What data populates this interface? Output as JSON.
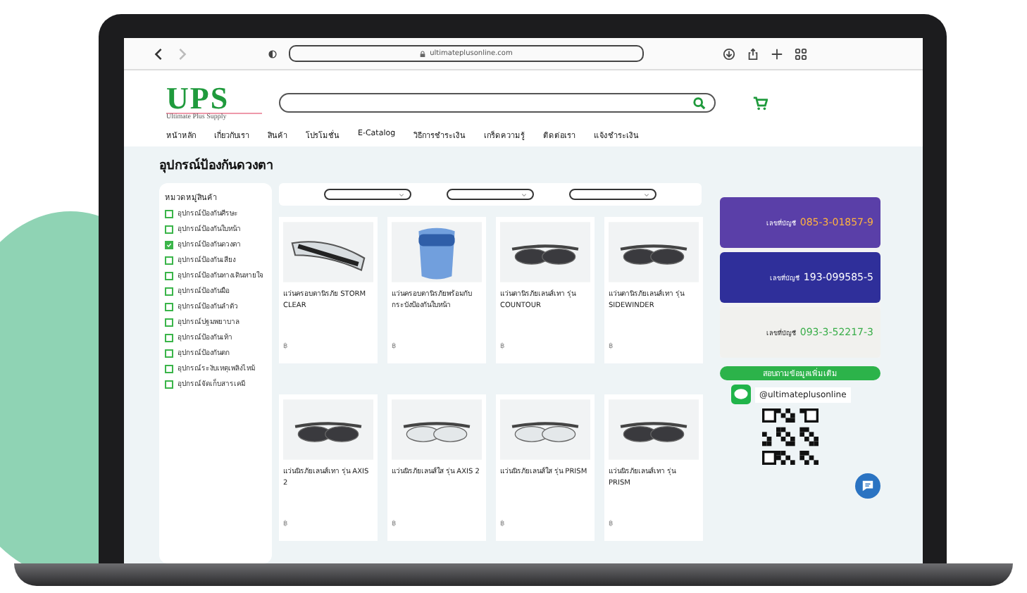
{
  "browser": {
    "url": "ultimateplusonline.com"
  },
  "logo": {
    "mark": "UPS",
    "tagline": "Ultimate Plus Supply"
  },
  "nav": [
    "หน้าหลัก",
    "เกี่ยวกับเรา",
    "สินค้า",
    "โปรโมชั่น",
    "E-Catalog",
    "วิธีการชำระเงิน",
    "เกร็ดความรู้",
    "ติดต่อเรา",
    "แจ้งชำระเงิน"
  ],
  "page_title": "อุปกรณ์ป้องกันดวงตา",
  "sidebar": {
    "title": "หมวดหมู่สินค้า",
    "items": [
      {
        "label": "อุปกรณ์ป้องกันศีรษะ",
        "checked": false
      },
      {
        "label": "อุปกรณ์ป้องกันใบหน้า",
        "checked": false
      },
      {
        "label": "อุปกรณ์ป้องกันดวงตา",
        "checked": true
      },
      {
        "label": "อุปกรณ์ป้องกันเสียง",
        "checked": false
      },
      {
        "label": "อุปกรณ์ป้องกันทางเดินหายใจ",
        "checked": false
      },
      {
        "label": "อุปกรณ์ป้องกันมือ",
        "checked": false
      },
      {
        "label": "อุปกรณ์ป้องกันลำตัว",
        "checked": false
      },
      {
        "label": "อุปกรณ์ปฐมพยาบาล",
        "checked": false
      },
      {
        "label": "อุปกรณ์ป้องกันเท้า",
        "checked": false
      },
      {
        "label": "อุปกรณ์ป้องกันตก",
        "checked": false
      },
      {
        "label": "อุปกรณ์ระงับเหตุเพลิงไหม้",
        "checked": false
      },
      {
        "label": "อุปกรณ์จัดเก็บสารเคมี",
        "checked": false
      }
    ]
  },
  "products": [
    {
      "name": "แว่นครอบตานิรภัย STORM CLEAR",
      "price": "฿",
      "kind": "goggles"
    },
    {
      "name": "แว่นครอบตานิรภัยพร้อมกับกระบังป้องกันใบหน้า",
      "price": "฿",
      "kind": "faceshield"
    },
    {
      "name": "แว่นตานิรภัยเลนส์เทา รุ่น COUNTOUR",
      "price": "฿",
      "kind": "dark"
    },
    {
      "name": "แว่นตานิรภัยเลนส์เทา รุ่น SIDEWINDER",
      "price": "฿",
      "kind": "dark"
    },
    {
      "name": "แว่นนิรภัยเลนส์เทา รุ่น AXIS 2",
      "price": "฿",
      "kind": "dark"
    },
    {
      "name": "แว่นนิรภัยเลนส์ใส รุ่น AXIS 2",
      "price": "฿",
      "kind": "clear"
    },
    {
      "name": "แว่นนิรภัยเลนส์ใส รุ่น PRISM",
      "price": "฿",
      "kind": "clear"
    },
    {
      "name": "แว่นนิรภัยเลนส์เทา รุ่น PRISM",
      "price": "฿",
      "kind": "dark"
    }
  ],
  "payment_cards": [
    {
      "label": "เลขที่บัญชี",
      "account": "085-3-01857-9",
      "color": "#5a3fa8"
    },
    {
      "label": "เลขที่บัญชี",
      "account": "193-099585-5",
      "color": "#2f2f9a"
    },
    {
      "label": "เลขที่บัญชี",
      "account": "093-3-52217-3",
      "color": "#f1f1ee"
    }
  ],
  "contact": {
    "button": "สอบถามข้อมูลเพิ่มเติม",
    "line_id": "@ultimateplusonline"
  }
}
